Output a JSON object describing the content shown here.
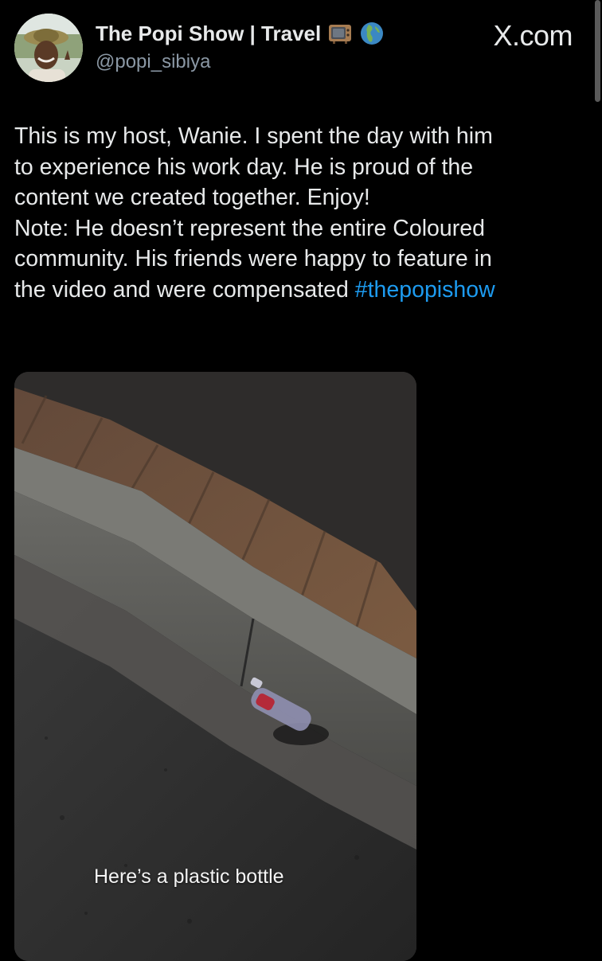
{
  "author": {
    "name": "The Popi Show | Travel",
    "handle": "@popi_sibiya",
    "emoji_icons": [
      "tv-icon",
      "globe-icon"
    ]
  },
  "source": {
    "label": "X.com"
  },
  "tweet": {
    "lines": [
      "This is my host, Wanie. I spent the day with him",
      "to experience his work day. He is proud of the",
      "content we created together. Enjoy!",
      "Note: He doesn’t represent the entire Coloured",
      "community. His friends were happy to feature in",
      "the video and were compensated "
    ],
    "hashtag": "#thepopishow"
  },
  "media": {
    "caption": "Here’s a plastic bottle"
  },
  "colors": {
    "background": "#000000",
    "text": "#e7e9ea",
    "secondary_text": "#8b98a5",
    "link": "#1d9bf0"
  }
}
